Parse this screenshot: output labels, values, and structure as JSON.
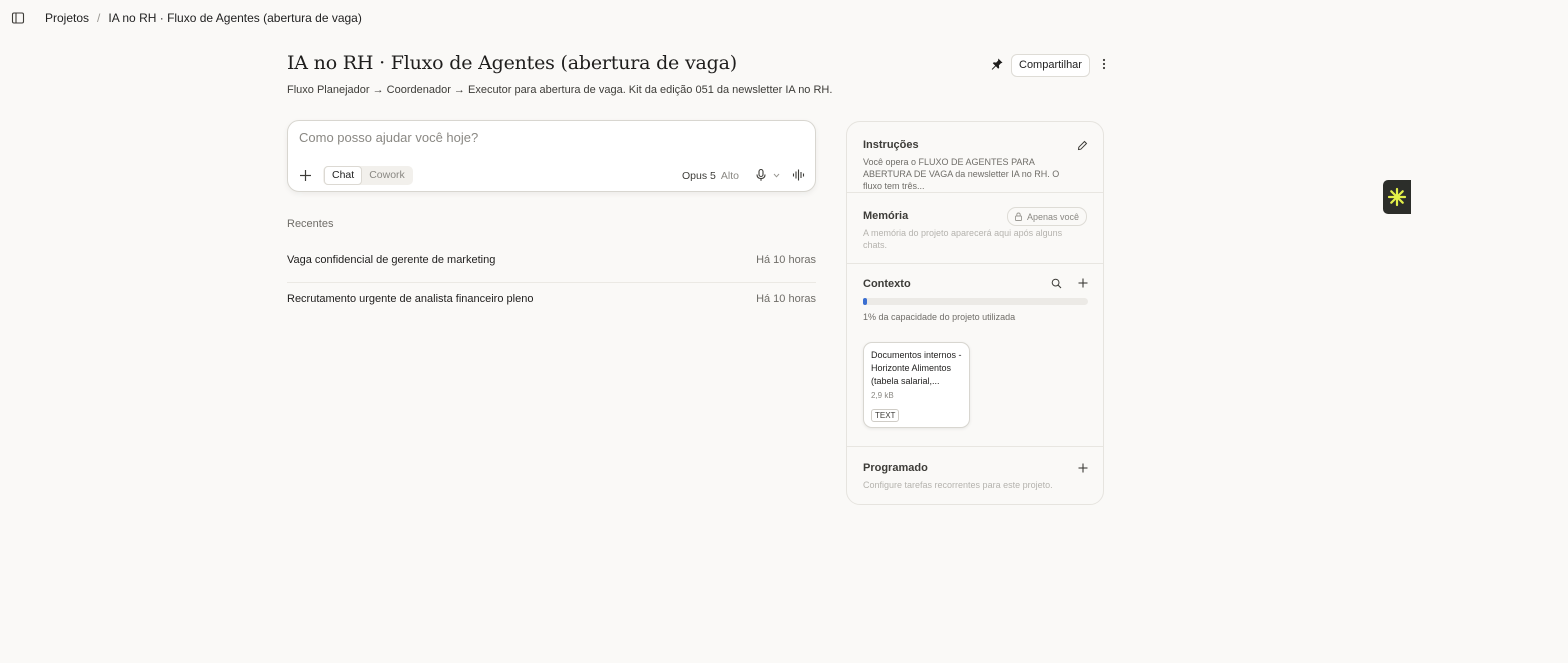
{
  "breadcrumb": {
    "root": "Projetos",
    "separator": "/",
    "current": "IA no RH · Fluxo de Agentes (abertura de vaga)"
  },
  "project": {
    "title": "IA no RH · Fluxo de Agentes (abertura de vaga)",
    "description": "Fluxo Planejador → Coordenador → Executor para abertura de vaga. Kit da edição 051 da newsletter IA no RH.",
    "share_label": "Compartilhar"
  },
  "composer": {
    "placeholder": "Como posso ajudar você hoje?",
    "value": "",
    "mode_active": "Chat",
    "mode_inactive": "Cowork",
    "model": "Opus 5",
    "effort": "Alto"
  },
  "recents": {
    "label": "Recentes",
    "items": [
      {
        "name": "Vaga confidencial de gerente de marketing",
        "time": "Há 10 horas"
      },
      {
        "name": "Recrutamento urgente de analista financeiro pleno",
        "time": "Há 10 horas"
      }
    ]
  },
  "panel": {
    "instructions": {
      "title": "Instruções",
      "text": "Você opera o FLUXO DE AGENTES PARA ABERTURA DE VAGA da newsletter IA no RH. O fluxo tem três..."
    },
    "memory": {
      "title": "Memória",
      "badge": "Apenas você",
      "text": "A memória do projeto aparecerá aqui após alguns chats."
    },
    "context": {
      "title": "Contexto",
      "capacity_percent": 1,
      "capacity_text": "1% da capacidade do projeto utilizada",
      "file": {
        "name": "Documentos internos - Horizonte Alimentos (tabela salarial,...",
        "size": "2,9 kB",
        "type": "TEXT"
      }
    },
    "scheduled": {
      "title": "Programado",
      "text": "Configure tarefas recorrentes para este projeto."
    }
  },
  "colors": {
    "background": "#faf9f7",
    "progress": "#3b6fd1",
    "badge_bg": "#2c2e2a",
    "badge_icon": "#e3f04a"
  },
  "icons": [
    "sidebar-toggle-icon",
    "pin-icon",
    "more-icon",
    "plus-icon",
    "mic-icon",
    "chevron-down-icon",
    "voice-icon",
    "pencil-icon",
    "lock-icon",
    "search-icon",
    "spark-icon"
  ]
}
